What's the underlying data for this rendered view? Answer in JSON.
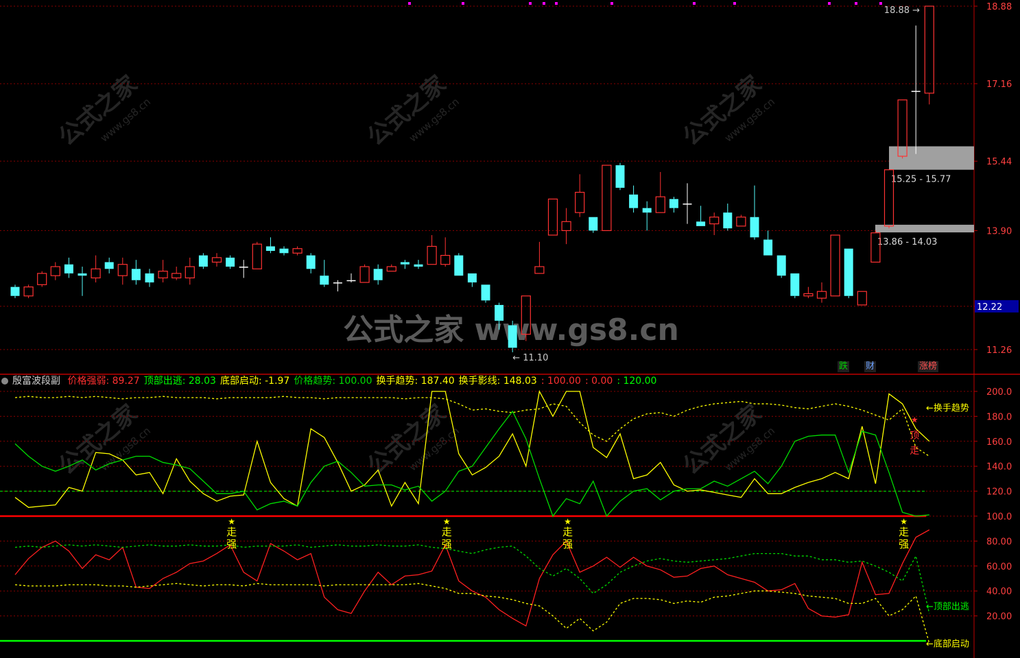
{
  "watermark": {
    "url_text": "公式之家 www.gs8.cn",
    "small_text": "公式之家",
    "small_url": "www.gs8.cn"
  },
  "colors": {
    "bg": "#000000",
    "up": "#ff3232",
    "down": "#54fcfc",
    "grid": "#8b0000",
    "axis": "#c00000",
    "yellow": "#ffff00",
    "green": "#00dc00",
    "red": "#ff0000"
  },
  "price_panel": {
    "y_ticks": [
      "18.88",
      "17.16",
      "15.44",
      "13.90",
      "12.22",
      "11.26"
    ],
    "last_price": "12.22",
    "high_label": "18.88",
    "low_label": "11.10",
    "zones": [
      {
        "label": "15.25 - 15.77",
        "low": 15.25,
        "high": 15.77
      },
      {
        "label": "13.86 - 14.03",
        "low": 13.86,
        "high": 14.03
      }
    ],
    "buttons": [
      {
        "label": "跌",
        "color": "#00d000"
      },
      {
        "label": "财",
        "color": "#6aa0ff"
      },
      {
        "label": "涨榜",
        "color": "#ff5050"
      }
    ]
  },
  "indicator": {
    "name": "殷富波段副",
    "params": [
      {
        "label": "价格强弱: 89.27",
        "color": "#ff3030"
      },
      {
        "label": "顶部出逃: 28.03",
        "color": "#00ff00"
      },
      {
        "label": "底部启动: -1.97",
        "color": "#ffff00"
      },
      {
        "label": "价格趋势: 100.00",
        "color": "#00dc00"
      },
      {
        "label": "换手趋势: 187.40",
        "color": "#ffff00"
      },
      {
        "label": "换手影线: 148.03",
        "color": "#ffff00"
      },
      {
        "label": ": 100.00",
        "color": "#ff3030"
      },
      {
        "label": ": 0.00",
        "color": "#ff3030"
      },
      {
        "label": ": 120.00",
        "color": "#00ff00"
      }
    ],
    "y_ticks": [
      "200.0",
      "180.0",
      "160.0",
      "140.0",
      "120.0",
      "100.0",
      "80.00",
      "60.00",
      "40.00",
      "20.00"
    ],
    "line_labels": [
      "←换手趋势",
      "←顶部出逃",
      "←底部启动"
    ],
    "signal_text": "走强",
    "signal_text_top": "顶走"
  },
  "chart_data": [
    {
      "type": "candlestick",
      "ylim": [
        10.9,
        19.0
      ],
      "y_ticks": [
        18.88,
        17.16,
        15.44,
        13.9,
        12.22,
        11.26
      ],
      "candles": [
        [
          12.65,
          12.45,
          12.7,
          12.4
        ],
        [
          12.45,
          12.65,
          12.7,
          12.4
        ],
        [
          12.7,
          12.95,
          13.0,
          12.65
        ],
        [
          12.9,
          13.1,
          13.2,
          12.8
        ],
        [
          13.15,
          12.95,
          13.3,
          12.85
        ],
        [
          12.95,
          12.9,
          13.1,
          12.45
        ],
        [
          12.85,
          13.05,
          13.35,
          12.75
        ],
        [
          13.2,
          13.05,
          13.3,
          12.95
        ],
        [
          12.9,
          13.15,
          13.3,
          12.7
        ],
        [
          13.05,
          12.8,
          13.25,
          12.7
        ],
        [
          12.95,
          12.75,
          13.05,
          12.65
        ],
        [
          12.85,
          13.0,
          13.25,
          12.75
        ],
        [
          12.85,
          12.95,
          13.1,
          12.8
        ],
        [
          12.85,
          13.1,
          13.3,
          12.7
        ],
        [
          13.35,
          13.1,
          13.4,
          13.05
        ],
        [
          13.2,
          13.3,
          13.4,
          13.1
        ],
        [
          13.3,
          13.1,
          13.35,
          13.05
        ],
        [
          13.1,
          13.1,
          13.25,
          12.85
        ],
        [
          13.05,
          13.6,
          13.65,
          13.05
        ],
        [
          13.55,
          13.45,
          13.75,
          13.4
        ],
        [
          13.5,
          13.4,
          13.55,
          13.35
        ],
        [
          13.4,
          13.5,
          13.55,
          13.35
        ],
        [
          13.35,
          13.05,
          13.4,
          12.95
        ],
        [
          12.9,
          12.7,
          13.25,
          12.65
        ],
        [
          12.75,
          12.75,
          12.8,
          12.55
        ],
        [
          12.8,
          12.8,
          12.95,
          12.75
        ],
        [
          12.75,
          13.1,
          13.15,
          12.75
        ],
        [
          13.05,
          12.8,
          13.15,
          12.7
        ],
        [
          13.0,
          13.1,
          13.15,
          13.0
        ],
        [
          13.2,
          13.15,
          13.25,
          13.05
        ],
        [
          13.15,
          13.1,
          13.25,
          13.05
        ],
        [
          13.15,
          13.55,
          13.8,
          13.15
        ],
        [
          13.15,
          13.35,
          13.75,
          13.1
        ],
        [
          13.35,
          12.9,
          13.4,
          12.9
        ],
        [
          12.95,
          12.75,
          12.95,
          12.65
        ],
        [
          12.7,
          12.35,
          12.7,
          12.3
        ],
        [
          12.25,
          11.9,
          12.3,
          11.7
        ],
        [
          11.8,
          11.3,
          11.9,
          11.2
        ],
        [
          11.6,
          12.45,
          12.45,
          11.45
        ],
        [
          12.95,
          13.1,
          13.65,
          12.95
        ],
        [
          13.8,
          14.6,
          14.6,
          13.8
        ],
        [
          13.9,
          14.1,
          14.4,
          13.6
        ],
        [
          14.3,
          14.75,
          15.15,
          14.2
        ],
        [
          14.2,
          13.9,
          14.2,
          13.85
        ],
        [
          13.9,
          15.35,
          15.35,
          13.9
        ],
        [
          15.35,
          14.85,
          15.4,
          14.8
        ],
        [
          14.7,
          14.4,
          14.9,
          14.3
        ],
        [
          14.4,
          14.3,
          14.55,
          13.9
        ],
        [
          14.3,
          14.65,
          15.2,
          14.3
        ],
        [
          14.6,
          14.4,
          14.65,
          14.3
        ],
        [
          14.5,
          14.5,
          14.95,
          14.05
        ],
        [
          14.1,
          14.0,
          14.45,
          14.0
        ],
        [
          14.05,
          14.2,
          14.3,
          13.8
        ],
        [
          14.3,
          13.95,
          14.5,
          13.9
        ],
        [
          14.0,
          14.2,
          14.25,
          14.0
        ],
        [
          14.2,
          13.75,
          14.9,
          13.7
        ],
        [
          13.7,
          13.35,
          13.9,
          13.35
        ],
        [
          13.35,
          12.9,
          13.35,
          12.85
        ],
        [
          12.95,
          12.45,
          12.95,
          12.4
        ],
        [
          12.45,
          12.5,
          12.65,
          12.4
        ],
        [
          12.4,
          12.55,
          12.75,
          12.3
        ],
        [
          12.45,
          13.8,
          13.8,
          12.45
        ],
        [
          13.5,
          12.45,
          13.5,
          12.4
        ],
        [
          12.25,
          12.55,
          12.55,
          12.25
        ],
        [
          13.2,
          13.85,
          13.9,
          13.2
        ],
        [
          14.0,
          15.25,
          15.25,
          13.95
        ],
        [
          15.55,
          16.8,
          16.8,
          15.5
        ],
        [
          17.0,
          17.0,
          18.45,
          15.6
        ],
        [
          16.95,
          18.88,
          18.88,
          16.7
        ]
      ]
    },
    {
      "type": "line",
      "ylim": [
        -5,
        205
      ],
      "y_ticks": [
        200,
        180,
        160,
        140,
        120,
        100,
        80,
        60,
        40,
        20
      ],
      "x_count": 69,
      "series": [
        {
          "name": "换手趋势",
          "style": "dotted",
          "color": "#ffff00",
          "values": [
            195,
            196,
            195,
            195,
            196,
            195,
            196,
            195,
            194,
            195,
            195,
            196,
            195,
            195,
            195,
            194,
            195,
            195,
            195,
            195,
            196,
            195,
            195,
            194,
            195,
            195,
            195,
            195,
            195,
            194,
            195,
            195,
            194,
            190,
            185,
            186,
            184,
            183,
            185,
            186,
            190,
            188,
            175,
            165,
            160,
            170,
            178,
            182,
            183,
            180,
            185,
            188,
            190,
            191,
            192,
            190,
            190,
            189,
            187,
            186,
            188,
            190,
            188,
            185,
            181,
            177,
            186,
            155,
            148
          ]
        },
        {
          "name": "换手影线",
          "style": "solid",
          "color": "#ffff00",
          "values": [
            115,
            107,
            108,
            109,
            123,
            120,
            151,
            150,
            145,
            133,
            135,
            118,
            146,
            128,
            118,
            112,
            116,
            117,
            160,
            127,
            114,
            108,
            170,
            163,
            143,
            120,
            125,
            137,
            108,
            127,
            110,
            200,
            200,
            150,
            133,
            139,
            148,
            166,
            140,
            200,
            180,
            200,
            200,
            155,
            147,
            166,
            130,
            133,
            143,
            125,
            120,
            121,
            119,
            117,
            115,
            130,
            118,
            118,
            123,
            127,
            130,
            135,
            130,
            172,
            126,
            198,
            190,
            170,
            160
          ]
        },
        {
          "name": "价格趋势",
          "style": "solid",
          "color": "#00dc00",
          "values": [
            158,
            148,
            140,
            136,
            140,
            145,
            137,
            142,
            145,
            148,
            148,
            143,
            141,
            138,
            128,
            118,
            118,
            120,
            105,
            110,
            112,
            108,
            127,
            140,
            144,
            135,
            124,
            125,
            125,
            121,
            124,
            112,
            120,
            136,
            140,
            155,
            170,
            184,
            162,
            130,
            100,
            114,
            110,
            128,
            100,
            112,
            120,
            122,
            113,
            120,
            122,
            122,
            128,
            124,
            130,
            136,
            126,
            140,
            160,
            164,
            165,
            165,
            135,
            168,
            165,
            135,
            103,
            100,
            101
          ]
        },
        {
          "name": "价格强弱",
          "style": "solid",
          "color": "#ff2020",
          "values": [
            53,
            66,
            75,
            80,
            72,
            58,
            69,
            65,
            75,
            43,
            42,
            50,
            55,
            62,
            64,
            70,
            77,
            55,
            48,
            78,
            72,
            65,
            70,
            35,
            25,
            22,
            40,
            55,
            45,
            52,
            53,
            56,
            77,
            48,
            40,
            35,
            25,
            18,
            12,
            50,
            69,
            80,
            55,
            60,
            67,
            59,
            67,
            60,
            57,
            51,
            52,
            58,
            60,
            53,
            50,
            47,
            40,
            41,
            46,
            26,
            20,
            19,
            21,
            63,
            37,
            38,
            62,
            83,
            89
          ]
        },
        {
          "name": "顶部出逃",
          "style": "dotted",
          "color": "#00dc00",
          "values": [
            75,
            76,
            75,
            76,
            77,
            76,
            77,
            76,
            75,
            76,
            77,
            76,
            76,
            77,
            76,
            76,
            77,
            75,
            76,
            76,
            76,
            77,
            75,
            76,
            77,
            76,
            76,
            77,
            76,
            76,
            77,
            75,
            74,
            72,
            70,
            73,
            75,
            76,
            68,
            58,
            52,
            58,
            50,
            38,
            45,
            55,
            60,
            64,
            66,
            64,
            63,
            64,
            65,
            66,
            68,
            70,
            70,
            70,
            68,
            68,
            65,
            65,
            63,
            64,
            60,
            55,
            48,
            68,
            22
          ]
        },
        {
          "name": "底部启动",
          "style": "dotted",
          "color": "#ffff00",
          "values": [
            45,
            44,
            44,
            44,
            45,
            45,
            45,
            44,
            44,
            43,
            44,
            45,
            46,
            45,
            44,
            45,
            45,
            44,
            46,
            45,
            45,
            45,
            45,
            44,
            45,
            45,
            45,
            45,
            45,
            45,
            46,
            44,
            42,
            38,
            38,
            36,
            35,
            33,
            30,
            28,
            20,
            10,
            18,
            8,
            15,
            30,
            34,
            34,
            33,
            30,
            32,
            31,
            35,
            36,
            38,
            40,
            40,
            39,
            38,
            36,
            35,
            34,
            30,
            30,
            34,
            20,
            25,
            36,
            -2
          ]
        }
      ],
      "ref_lines": [
        100,
        0,
        120
      ]
    }
  ]
}
